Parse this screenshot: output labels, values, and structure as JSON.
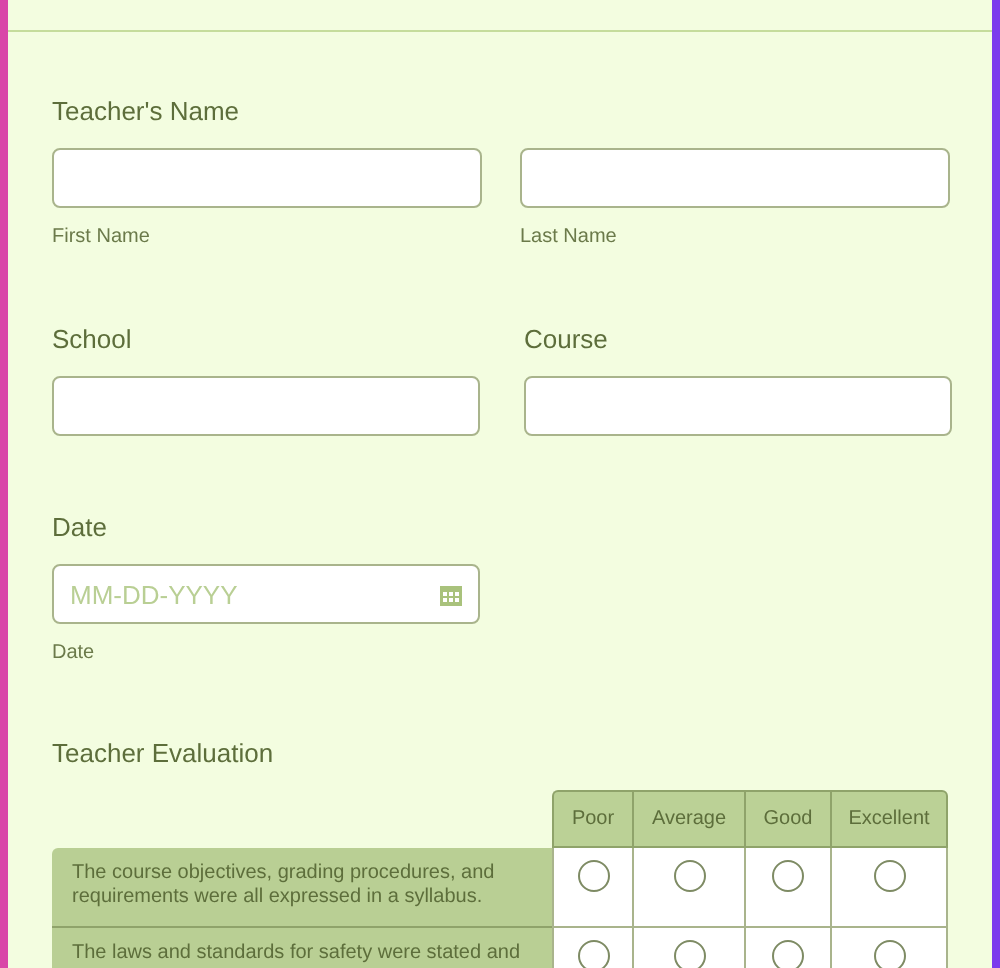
{
  "name_field": {
    "label": "Teacher's Name",
    "subfields": [
      {
        "sublabel": "First Name"
      },
      {
        "sublabel": "Last Name"
      }
    ]
  },
  "school": {
    "label": "School"
  },
  "course": {
    "label": "Course"
  },
  "date": {
    "label": "Date",
    "placeholder": "MM-DD-YYYY",
    "sublabel": "Date"
  },
  "evaluation": {
    "title": "Teacher Evaluation",
    "columns": [
      "Poor",
      "Average",
      "Good",
      "Excellent"
    ],
    "rows": [
      {
        "statement": "The course objectives, grading procedures, and requirements were all expressed in a syllabus.",
        "choices": [
          {
            "selected": false
          },
          {
            "selected": false
          },
          {
            "selected": false
          },
          {
            "selected": false
          }
        ]
      },
      {
        "statement": "The laws and standards for safety were stated and",
        "choices": [
          {
            "selected": false
          },
          {
            "selected": false
          },
          {
            "selected": false
          },
          {
            "selected": false
          }
        ]
      }
    ]
  }
}
